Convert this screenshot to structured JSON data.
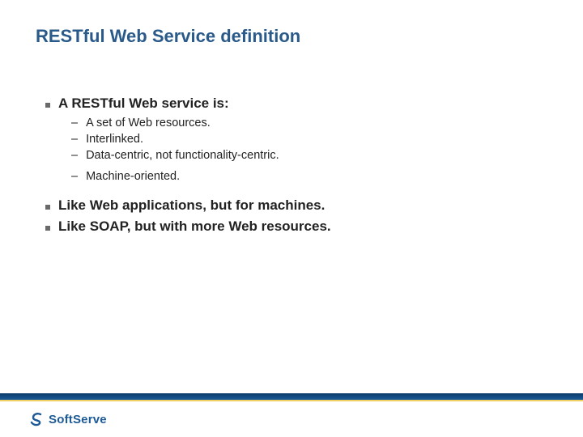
{
  "title": "RESTful Web Service definition",
  "bullets": {
    "intro": "A RESTful Web service is:",
    "subitems": [
      "A set of Web resources.",
      "Interlinked.",
      "Data-centric, not functionality-centric.",
      "Machine-oriented."
    ],
    "closing1": "Like Web applications, but for machines.",
    "closing2": "Like SOAP, but with more Web resources."
  },
  "footer": {
    "brand": "SoftServe"
  }
}
